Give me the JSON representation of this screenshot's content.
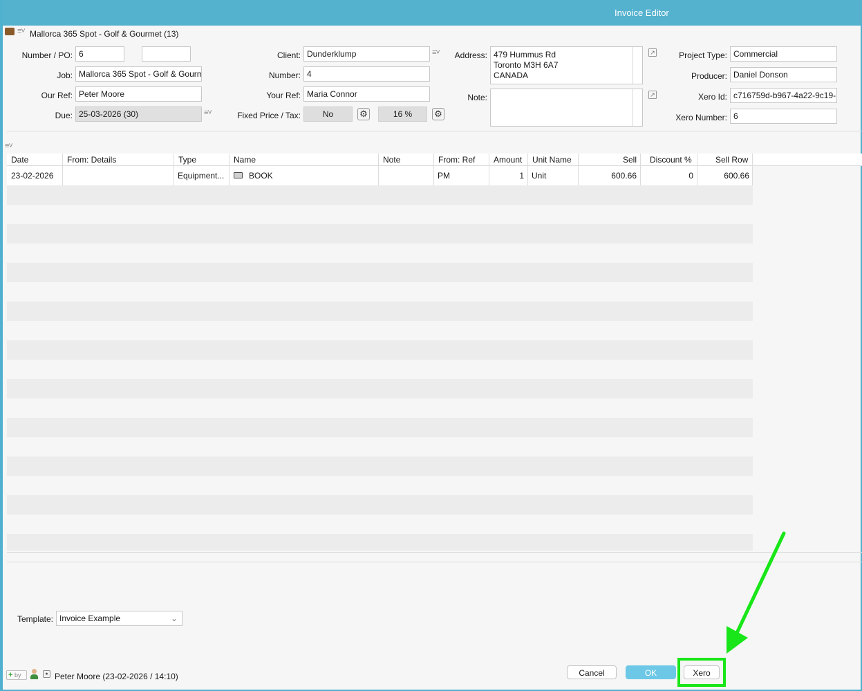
{
  "window": {
    "title": "Invoice Editor"
  },
  "project": {
    "label": "Mallorca 365 Spot - Golf & Gourmet (13)"
  },
  "form": {
    "number_po_label": "Number / PO:",
    "number_value": "6",
    "po_value": "",
    "job_label": "Job:",
    "job_value": "Mallorca 365 Spot - Golf & Gourm",
    "our_ref_label": "Our Ref:",
    "our_ref_value": "Peter Moore",
    "due_label": "Due:",
    "due_value": "25-03-2026 (30)",
    "client_label": "Client:",
    "client_value": "Dunderklump",
    "number_label": "Number:",
    "client_number_value": "4",
    "your_ref_label": "Your Ref:",
    "your_ref_value": "Maria Connor",
    "fixed_price_tax_label": "Fixed Price / Tax:",
    "fixed_price_value": "No",
    "tax_value": "16 %",
    "address_label": "Address:",
    "address_line1": "479 Hummus Rd",
    "address_line2": "Toronto M3H 6A7",
    "address_line3": "CANADA",
    "note_label": "Note:",
    "note_value": "",
    "project_type_label": "Project Type:",
    "project_type_value": "Commercial",
    "producer_label": "Producer:",
    "producer_value": "Daniel Donson",
    "xero_id_label": "Xero Id:",
    "xero_id_value": "c716759d-b967-4a22-9c19-",
    "xero_number_label": "Xero Number:",
    "xero_number_value": "6"
  },
  "table": {
    "headers": {
      "date": "Date",
      "from_details": "From: Details",
      "type": "Type",
      "name": "Name",
      "note": "Note",
      "from_ref": "From: Ref",
      "amount": "Amount",
      "unit_name": "Unit Name",
      "sell": "Sell",
      "discount": "Discount %",
      "sell_row": "Sell Row"
    },
    "rows": [
      {
        "date": "23-02-2026",
        "from_details": "",
        "type": "Equipment...",
        "name": "BOOK",
        "note": "",
        "from_ref": "PM",
        "amount": "1",
        "unit_name": "Unit",
        "sell": "600.66",
        "discount": "0",
        "sell_row": "600.66"
      }
    ]
  },
  "template": {
    "label": "Template:",
    "value": "Invoice Example"
  },
  "footer": {
    "by_label": "by",
    "created_by": "Peter Moore (23-02-2026 / 14:10)",
    "cancel_label": "Cancel",
    "ok_label": "OK",
    "xero_label": "Xero"
  },
  "colors": {
    "titlebar": "#55b2cf",
    "ok_button": "#6cc8e6",
    "highlight": "#19e619"
  }
}
